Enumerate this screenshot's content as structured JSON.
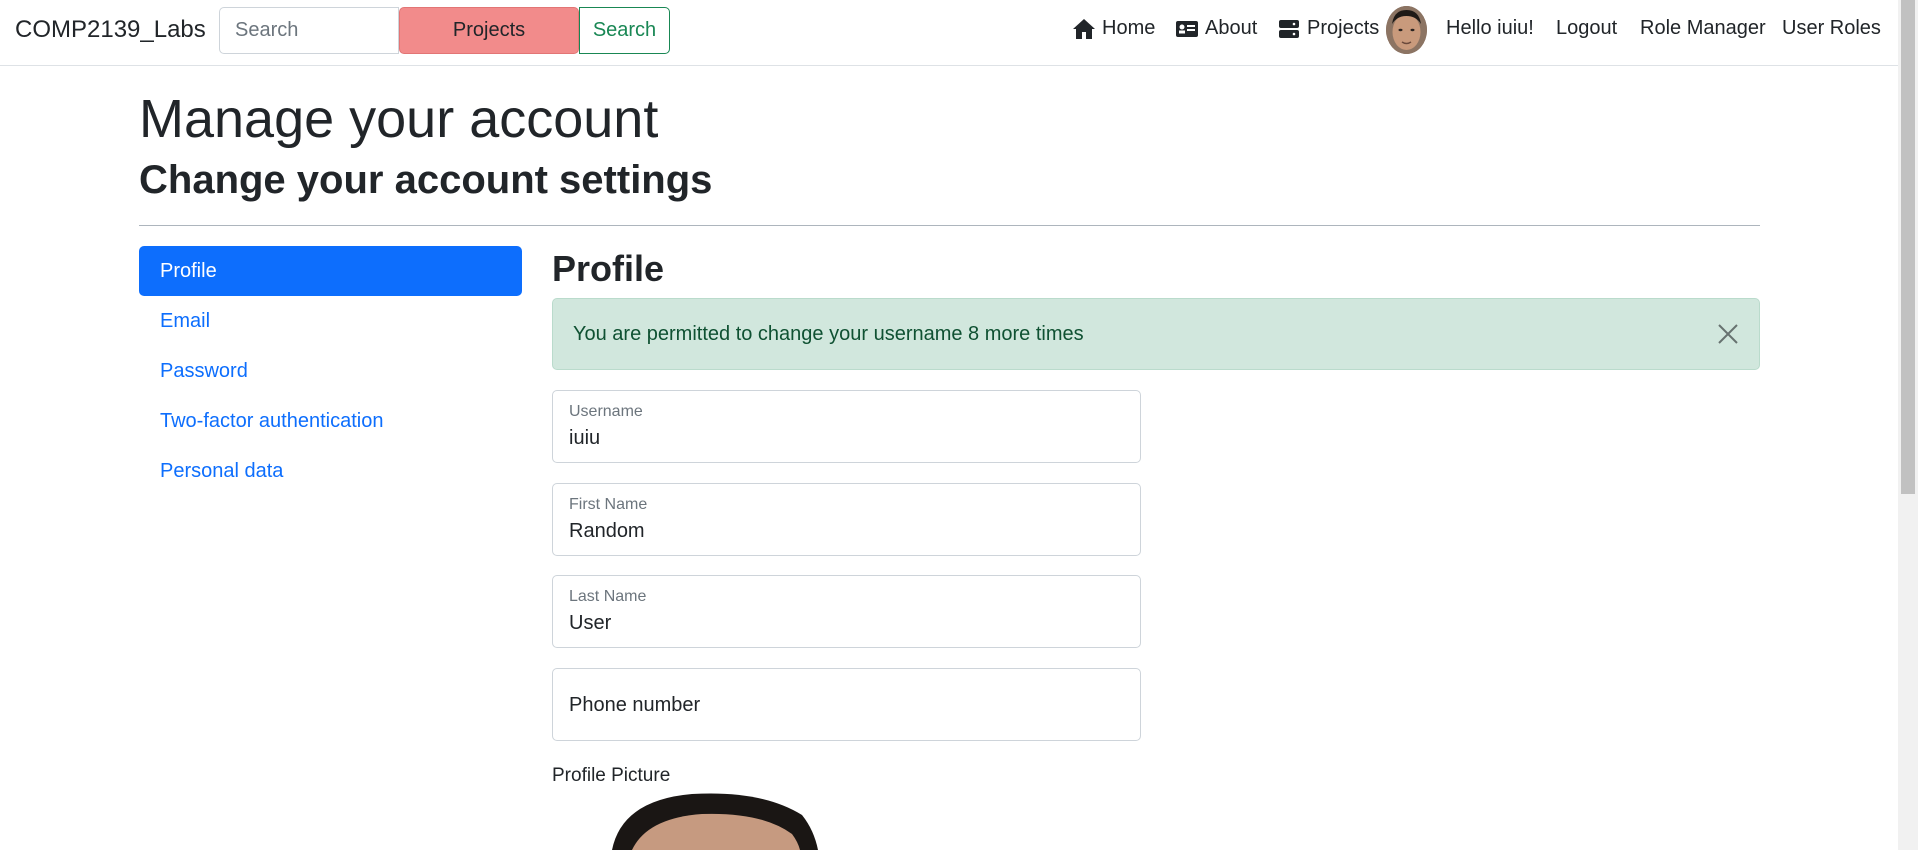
{
  "navbar": {
    "brand": "COMP2139_Labs",
    "search_placeholder": "Search",
    "projects_button": "Projects",
    "search_button": "Search",
    "links": {
      "home": "Home",
      "about": "About",
      "projects": "Projects",
      "greeting": "Hello iuiu!",
      "logout": "Logout",
      "role_manager": "Role Manager",
      "user_roles": "User Roles"
    }
  },
  "page": {
    "title": "Manage your account",
    "subtitle": "Change your account settings"
  },
  "sidebar": {
    "items": [
      {
        "label": "Profile",
        "active": true
      },
      {
        "label": "Email",
        "active": false
      },
      {
        "label": "Password",
        "active": false
      },
      {
        "label": "Two-factor authentication",
        "active": false
      },
      {
        "label": "Personal data",
        "active": false
      }
    ]
  },
  "content": {
    "heading": "Profile",
    "alert": "You are permitted to change your username 8 more times",
    "fields": {
      "username": {
        "label": "Username",
        "value": "iuiu"
      },
      "first_name": {
        "label": "First Name",
        "value": "Random"
      },
      "last_name": {
        "label": "Last Name",
        "value": "User"
      },
      "phone": {
        "placeholder": "Phone number"
      }
    },
    "profile_picture_label": "Profile Picture"
  },
  "colors": {
    "primary": "#0d6efd",
    "success": "#198754",
    "alert_bg": "#d1e7dd",
    "projects_btn": "#f28b8b"
  }
}
